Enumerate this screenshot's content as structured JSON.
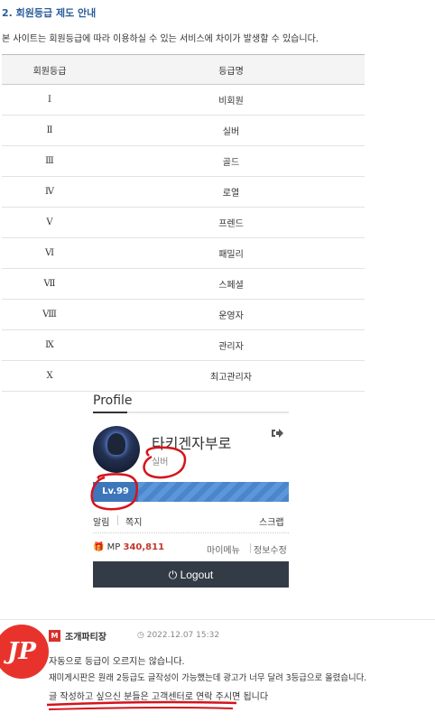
{
  "section": {
    "title": "2. 회원등급 제도 안내",
    "description": "본 사이트는 회원등급에 따라 이용하실 수 있는 서비스에 차이가 발생할 수 있습니다."
  },
  "grade_table": {
    "headers": [
      "회원등급",
      "등급명"
    ],
    "rows": [
      [
        "Ⅰ",
        "비회원"
      ],
      [
        "Ⅱ",
        "실버"
      ],
      [
        "Ⅲ",
        "골드"
      ],
      [
        "Ⅳ",
        "로열"
      ],
      [
        "Ⅴ",
        "프렌드"
      ],
      [
        "Ⅵ",
        "패밀리"
      ],
      [
        "Ⅶ",
        "스페셜"
      ],
      [
        "Ⅷ",
        "운영자"
      ],
      [
        "Ⅸ",
        "관리자"
      ],
      [
        "Ⅹ",
        "최고관리자"
      ]
    ]
  },
  "profile": {
    "title": "Profile",
    "username": "타키겐자부로",
    "grade": "실버",
    "level": "Lv.99",
    "links": {
      "alarm": "알림",
      "note": "쪽지",
      "scrap": "스크랩"
    },
    "mp_label": "MP",
    "mp_value": "340,811",
    "mymenu": "마이메뉴",
    "edit_info": "정보수정",
    "logout": "Logout",
    "logout_icon": "sign-out-icon",
    "accent": "#3d76bb"
  },
  "comment": {
    "avatar_text": "JP",
    "badge": "M",
    "author": "조개파티장",
    "time": "2022.12.07 15:32",
    "lines": [
      "자동으로 등급이 오르지는 않습니다.",
      "재미게시판은 원래 2등급도 글작성이 가능했는데 광고가 너무 달려 3등급으로 올렸습니다.",
      "글 작성하고 싶으신 분들은 고객센터로 연락 주시면 됩니다"
    ],
    "annotation_color": "#d6131b"
  }
}
